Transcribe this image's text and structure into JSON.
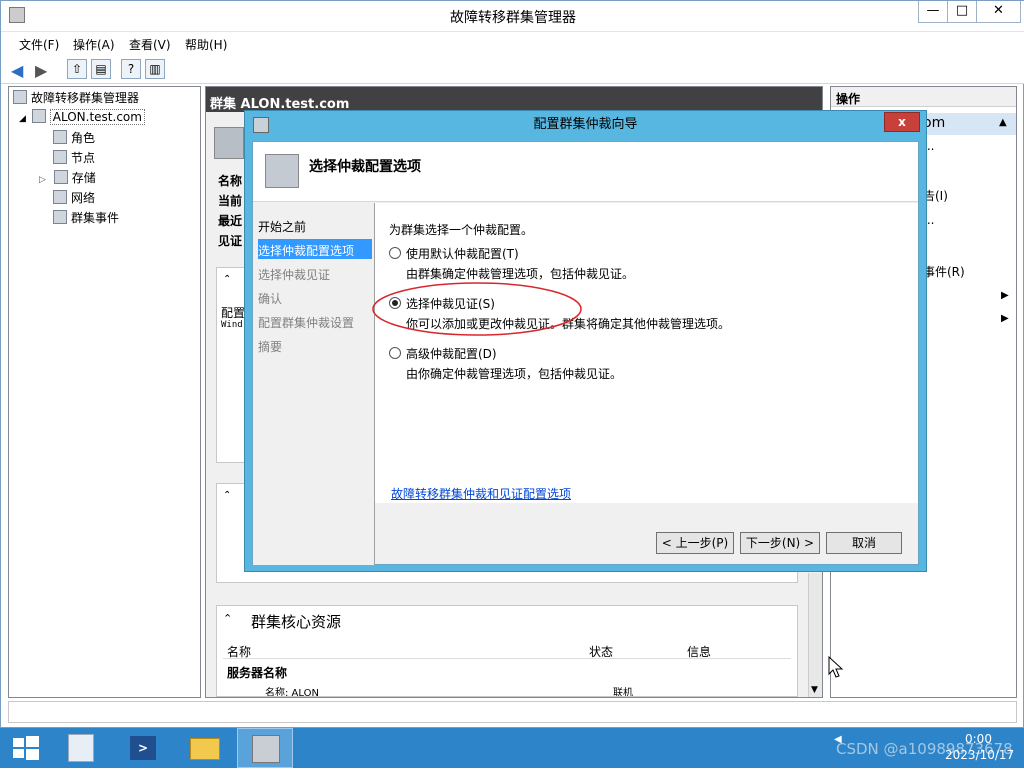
{
  "window": {
    "title": "故障转移群集管理器",
    "controls": [
      "—",
      "□",
      "✕"
    ]
  },
  "menu": [
    "文件(F)",
    "操作(A)",
    "查看(V)",
    "帮助(H)"
  ],
  "tree": {
    "root": "故障转移群集管理器",
    "cluster": "ALON.test.com",
    "items": [
      "角色",
      "节点",
      "存储",
      "网络",
      "群集事件"
    ]
  },
  "center": {
    "header": "群集 ALON.test.com",
    "summary_labels": [
      "名称",
      "当前",
      "最近",
      "见证"
    ],
    "partial": [
      "配置",
      "Wind"
    ],
    "core_section": "群集核心资源",
    "core_columns": [
      "名称",
      "状态",
      "信息"
    ],
    "core_group": "服务器名称",
    "core_row_name": "名称: ALON",
    "core_row_status": "联机"
  },
  "actions": {
    "header": "操作",
    "cluster_fragment": "om",
    "fragments": [
      "...",
      "告(I)",
      "...",
      "事件(R)"
    ]
  },
  "dialog": {
    "title": "配置群集仲裁向导",
    "close": "x",
    "heading": "选择仲裁配置选项",
    "steps": [
      "开始之前",
      "选择仲裁配置选项",
      "选择仲裁见证",
      "确认",
      "配置群集仲裁设置",
      "摘要"
    ],
    "prompt": "为群集选择一个仲裁配置。",
    "options": [
      {
        "label": "使用默认仲裁配置(T)",
        "desc": "由群集确定仲裁管理选项，包括仲裁见证。",
        "selected": false
      },
      {
        "label": "选择仲裁见证(S)",
        "desc": "你可以添加或更改仲裁见证。群集将确定其他仲裁管理选项。",
        "selected": true
      },
      {
        "label": "高级仲裁配置(D)",
        "desc": "由你确定仲裁管理选项，包括仲裁见证。",
        "selected": false
      }
    ],
    "help_link": "故障转移群集仲裁和见证配置选项",
    "buttons": {
      "back": "< 上一步(P)",
      "next": "下一步(N) >",
      "cancel": "取消"
    }
  },
  "taskbar": {
    "time": "0:00",
    "date": "2023/10/17",
    "watermark": "CSDN @a10989873678"
  },
  "colors": {
    "accent": "#57b7e0",
    "selection": "#3399ff",
    "annotation": "#d9262c",
    "taskbar": "#2d84c8"
  }
}
